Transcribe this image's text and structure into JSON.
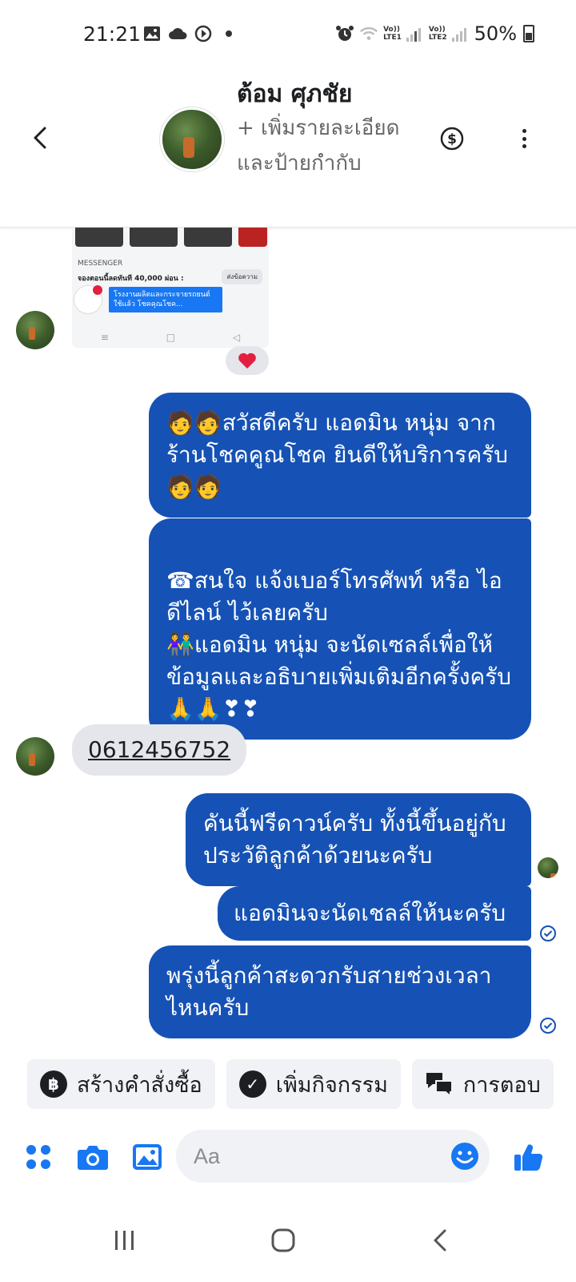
{
  "status_bar": {
    "time": "21:21",
    "sim1": [
      "Vo))",
      "LTE1"
    ],
    "sim2": [
      "Vo))",
      "LTE2"
    ],
    "battery": "50%"
  },
  "header": {
    "contact_name": "ต้อม ศุภชัย",
    "add_details": "+ เพิ่มรายละเอียดและป้ายกำกับ"
  },
  "shared_image": {
    "messenger_label": "MESSENGER",
    "line_text": "จองตอนนี้ลดทันที 40,000 ผ่อน :",
    "send_label": "ส่งข้อความ",
    "tooltip": "โรงงานผลิตและกระจายรถยนต์ใช้แล้ว โชคคุณโชค..."
  },
  "reaction": "❤️",
  "messages": [
    {
      "from": "me",
      "text": "🧑🧑สวัสดีครับ แอดมิน หนุ่ม จากร้านโชคคูณโชค ยินดีให้บริการครับ🧑🧑"
    },
    {
      "from": "me",
      "text": "☎สนใจ แจ้งเบอร์โทรศัพท์ หรือ ไอดีไลน์  ไว้เลยครับ\n👫แอดมิน หนุ่ม จะนัดเซลล์เพื่อให้ข้อมูลและอธิบายเพิ่มเติมอีกครั้งครับ🙏🙏❣❣"
    },
    {
      "from": "them",
      "text": "0612456752"
    },
    {
      "from": "me",
      "text": "คันนี้ฟรีดาวน์ครับ ทั้งนี้ขึ้นอยู่กับประวัติลูกค้าด้วยนะครับ"
    },
    {
      "from": "me",
      "text": "แอดมินจะนัดเชลล์ให้นะครับ"
    },
    {
      "from": "me",
      "text": "พรุ่งนี้ลูกค้าสะดวกรับสายช่วงเวลาไหนครับ"
    }
  ],
  "quick_actions": [
    {
      "icon": "฿",
      "label": "สร้างคำสั่งซื้อ"
    },
    {
      "icon": "✓",
      "label": "เพิ่มกิจกรรม"
    },
    {
      "icon": "",
      "label": "การตอบ"
    }
  ],
  "composer": {
    "placeholder": "Aa"
  },
  "colors": {
    "outgoing_bubble": "#1652b5",
    "incoming_bubble": "#e4e6eb",
    "accent": "#1877f2"
  }
}
